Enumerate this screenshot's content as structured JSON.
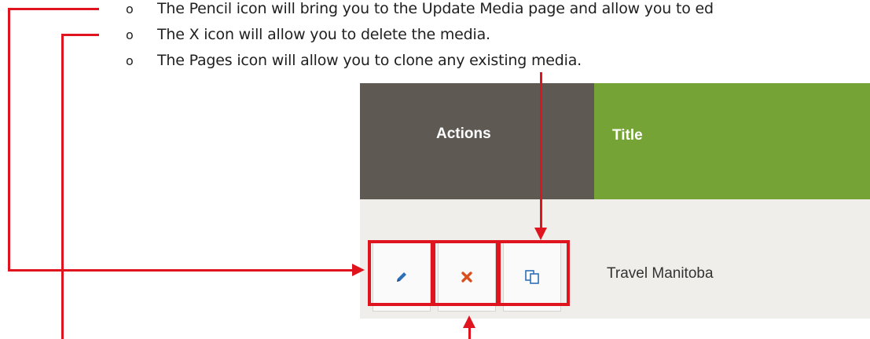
{
  "bullets": [
    {
      "marker": "o",
      "text": "The Pencil icon will bring you to the Update Media page and allow you to ed"
    },
    {
      "marker": "o",
      "text": "The X icon will allow you to delete the media."
    },
    {
      "marker": "o",
      "text": "The Pages icon will allow you to clone any existing media."
    }
  ],
  "table": {
    "headers": {
      "actions": "Actions",
      "title": "Title"
    },
    "row": {
      "actions": [
        {
          "icon": "pencil-icon",
          "color": "#2d6fb8"
        },
        {
          "icon": "x-icon",
          "color": "#d9501e"
        },
        {
          "icon": "pages-icon",
          "color": "#2d6fb8"
        }
      ],
      "title": "Travel Manitoba"
    }
  },
  "colors": {
    "annotation_red": "#e0141e",
    "actions_header": "#5e5953",
    "title_header": "#75a336"
  }
}
